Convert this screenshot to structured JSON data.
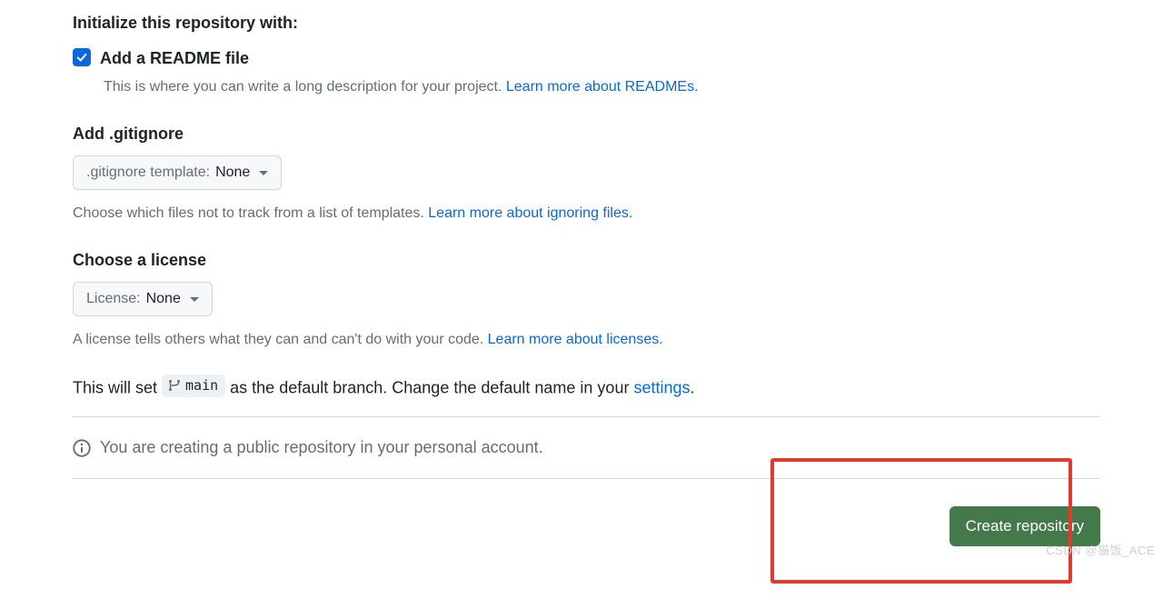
{
  "init": {
    "heading": "Initialize this repository with:",
    "readme_checked": true,
    "readme_label": "Add a README file",
    "readme_desc_prefix": "This is where you can write a long description for your project. ",
    "readme_link": "Learn more about READMEs."
  },
  "gitignore": {
    "heading": "Add .gitignore",
    "dd_label": ".gitignore template: ",
    "dd_value": "None",
    "help_prefix": "Choose which files not to track from a list of templates. ",
    "help_link": "Learn more about ignoring files."
  },
  "license": {
    "heading": "Choose a license",
    "dd_label": "License: ",
    "dd_value": "None",
    "help_prefix": "A license tells others what they can and can't do with your code. ",
    "help_link": "Learn more about licenses."
  },
  "branch": {
    "prefix": "This will set ",
    "name": "main",
    "mid": " as the default branch. Change the default name in your ",
    "settings_link": "settings",
    "suffix": "."
  },
  "info": {
    "text": "You are creating a public repository in your personal account."
  },
  "action": {
    "create_label": "Create repository"
  },
  "watermark": "CSDN @猫饭_ACE"
}
